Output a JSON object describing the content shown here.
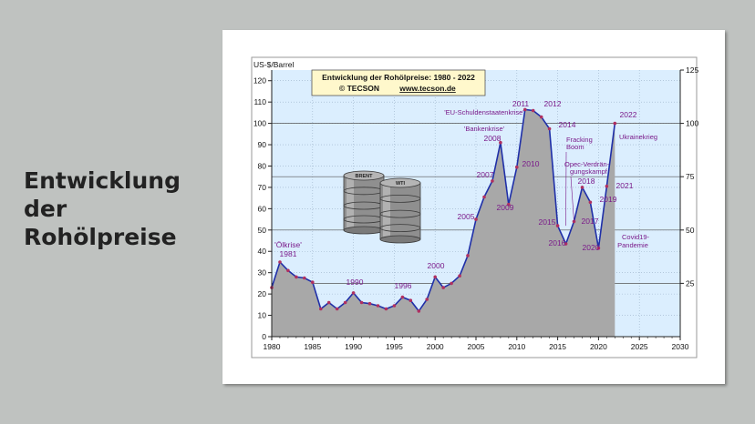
{
  "slide": {
    "title_lines": [
      "Entwicklung",
      "der",
      "Rohölpreise"
    ]
  },
  "chart_data": {
    "type": "area",
    "title": "Entwicklung der Rohölpreise:  1980 - 2022",
    "subtitle_left": "© TECSON",
    "subtitle_right": "www.tecson.de",
    "ylabel": "US-$/Barrel",
    "xlim": [
      1980,
      2030
    ],
    "ylim": [
      0,
      125
    ],
    "x_ticks": [
      1980,
      1985,
      1990,
      1995,
      2000,
      2005,
      2010,
      2015,
      2020,
      2025,
      2030
    ],
    "y_ticks_left": [
      0,
      10,
      20,
      30,
      40,
      50,
      60,
      70,
      80,
      90,
      100,
      110,
      120
    ],
    "y_ticks_right": [
      25,
      50,
      75,
      100,
      125
    ],
    "grid": true,
    "colors": {
      "plot_background": "#dbeefe",
      "area_fill": "#a8a8a8",
      "line": "#1f2fa8",
      "marker": "#b03060",
      "label_text": "#7a1a8a",
      "title_box": "#fff8cc"
    },
    "series": [
      {
        "x": [
          1980,
          1981,
          1982,
          1983,
          1984,
          1985,
          1986,
          1987,
          1988,
          1989,
          1990,
          1991,
          1992,
          1993,
          1994,
          1995,
          1996,
          1997,
          1998,
          1999,
          2000,
          2001,
          2002,
          2003,
          2004,
          2005,
          2006,
          2007,
          2008,
          2009,
          2010,
          2011,
          2012,
          2013,
          2014,
          2015,
          2016,
          2017,
          2018,
          2019,
          2020,
          2021,
          2022
        ],
        "values": [
          23,
          35,
          31,
          28,
          27.5,
          25.5,
          13,
          16,
          13,
          16,
          20.5,
          16,
          15.5,
          14.5,
          13,
          14.5,
          18.5,
          17,
          12,
          17.5,
          28,
          23,
          25,
          28.5,
          38,
          55,
          65.5,
          73,
          91,
          62,
          79.5,
          106.5,
          106,
          103,
          97.5,
          52,
          43.5,
          54,
          70,
          63,
          41.5,
          70.5,
          100
        ]
      }
    ],
    "annotations": [
      {
        "text": "'Ölkrise'",
        "x": 1981
      },
      {
        "text": "1981",
        "x": 1981
      },
      {
        "text": "1990",
        "x": 1990
      },
      {
        "text": "1996",
        "x": 1996
      },
      {
        "text": "2000",
        "x": 2000
      },
      {
        "text": "2005",
        "x": 2005
      },
      {
        "text": "2007",
        "x": 2007
      },
      {
        "text": "2008",
        "x": 2008
      },
      {
        "text": "'Bankenkrise'",
        "x": 2008
      },
      {
        "text": "2009",
        "x": 2009
      },
      {
        "text": "2010",
        "x": 2010
      },
      {
        "text": "2011",
        "x": 2011
      },
      {
        "text": "'EU-Schuldenstaatenkrise'",
        "x": 2011
      },
      {
        "text": "2012",
        "x": 2012
      },
      {
        "text": "2014",
        "x": 2014
      },
      {
        "text": "Fracking",
        "x": 2016
      },
      {
        "text": "Boom",
        "x": 2016
      },
      {
        "text": "Opec-Verdrän-",
        "x": 2017
      },
      {
        "text": "gungskampf",
        "x": 2017
      },
      {
        "text": "2015",
        "x": 2015
      },
      {
        "text": "2016",
        "x": 2016
      },
      {
        "text": "2017",
        "x": 2017
      },
      {
        "text": "2018",
        "x": 2018
      },
      {
        "text": "2019",
        "x": 2019
      },
      {
        "text": "2020",
        "x": 2020
      },
      {
        "text": "Covid19-",
        "x": 2020
      },
      {
        "text": "Pandemie",
        "x": 2020
      },
      {
        "text": "2021",
        "x": 2021
      },
      {
        "text": "2022",
        "x": 2022
      },
      {
        "text": "Ukrainekrieg",
        "x": 2022
      }
    ],
    "barrels": [
      {
        "label": "BRENT"
      },
      {
        "label": "WTI"
      }
    ]
  }
}
